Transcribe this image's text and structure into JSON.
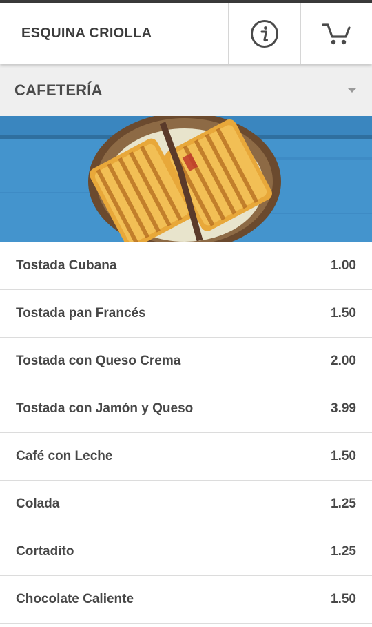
{
  "header": {
    "title": "ESQUINA CRIOLLA",
    "info_icon": "info-icon",
    "cart_icon": "cart-icon"
  },
  "category": {
    "label": "CAFETERÍA",
    "icon": "dropdown-caret-icon"
  },
  "banner": {
    "image": "toasted-sandwich-photo"
  },
  "menu": {
    "items": [
      {
        "name": "Tostada Cubana",
        "price": "1.00"
      },
      {
        "name": "Tostada pan Francés",
        "price": "1.50"
      },
      {
        "name": "Tostada con Queso Crema",
        "price": "2.00"
      },
      {
        "name": "Tostada con Jamón y Queso",
        "price": "3.99"
      },
      {
        "name": "Café con Leche",
        "price": "1.50"
      },
      {
        "name": "Colada",
        "price": "1.25"
      },
      {
        "name": "Cortadito",
        "price": "1.25"
      },
      {
        "name": "Chocolate Caliente",
        "price": "1.50"
      }
    ]
  },
  "colors": {
    "header_bg": "#ffffff",
    "category_bg": "#efefef",
    "text": "#474747",
    "banner_blue": "#3f8fc7"
  }
}
